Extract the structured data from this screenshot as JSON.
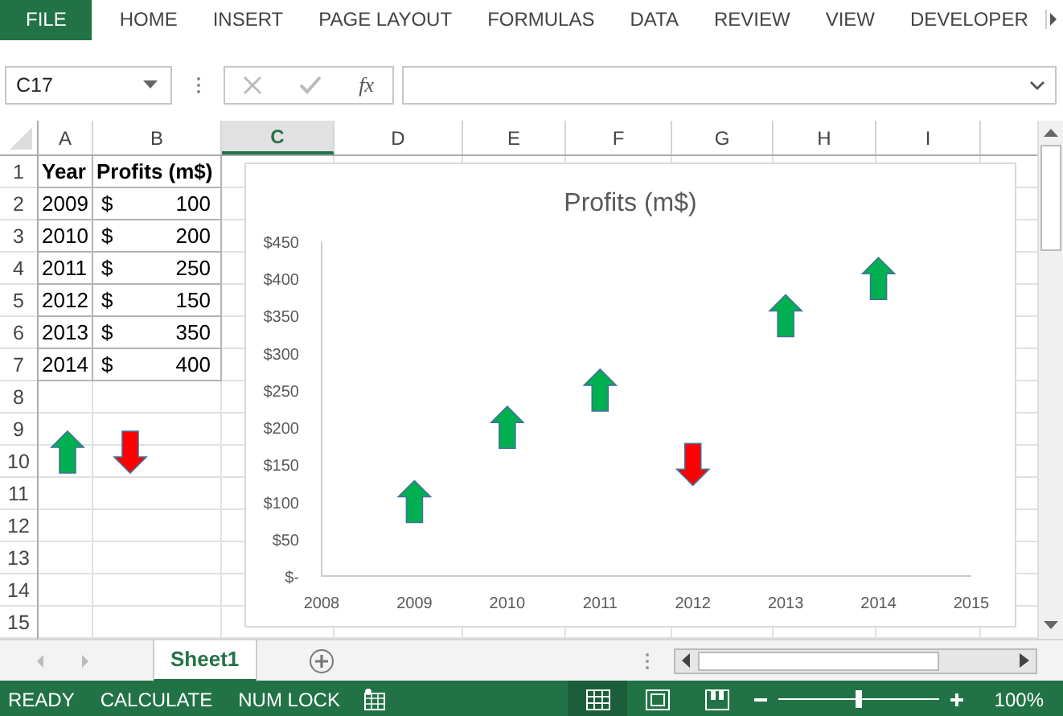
{
  "ribbon": {
    "tabs": [
      {
        "label": "FILE",
        "kind": "file"
      },
      {
        "label": "HOME",
        "kind": "tab"
      },
      {
        "label": "INSERT",
        "kind": "tab"
      },
      {
        "label": "PAGE LAYOUT",
        "kind": "tab"
      },
      {
        "label": "FORMULAS",
        "kind": "tab"
      },
      {
        "label": "DATA",
        "kind": "tab"
      },
      {
        "label": "REVIEW",
        "kind": "tab"
      },
      {
        "label": "VIEW",
        "kind": "tab"
      },
      {
        "label": "DEVELOPER",
        "kind": "tab"
      }
    ]
  },
  "formula_bar": {
    "name_box": "C17",
    "function_button": "fx"
  },
  "sheet": {
    "columns": [
      {
        "label": "A",
        "selected": false
      },
      {
        "label": "B",
        "selected": false
      },
      {
        "label": "C",
        "selected": true
      },
      {
        "label": "D",
        "selected": false
      },
      {
        "label": "E",
        "selected": false
      },
      {
        "label": "F",
        "selected": false
      },
      {
        "label": "G",
        "selected": false
      },
      {
        "label": "H",
        "selected": false
      },
      {
        "label": "I",
        "selected": false
      }
    ],
    "row_numbers": [
      "1",
      "2",
      "3",
      "4",
      "5",
      "6",
      "7",
      "8",
      "9",
      "10",
      "11",
      "12",
      "13",
      "14",
      "15"
    ],
    "table": {
      "header": [
        "Year",
        "Profits (m$)"
      ],
      "rows": [
        {
          "year": "2009",
          "currency": "$",
          "profit": "100"
        },
        {
          "year": "2010",
          "currency": "$",
          "profit": "200"
        },
        {
          "year": "2011",
          "currency": "$",
          "profit": "250"
        },
        {
          "year": "2012",
          "currency": "$",
          "profit": "150"
        },
        {
          "year": "2013",
          "currency": "$",
          "profit": "350"
        },
        {
          "year": "2014",
          "currency": "$",
          "profit": "400"
        }
      ]
    },
    "shapes": [
      {
        "kind": "up",
        "color": "#00b050"
      },
      {
        "kind": "down",
        "color": "#ff0000"
      }
    ],
    "chart": {
      "chart_data": {
        "type": "scatter",
        "title": "Profits (m$)",
        "x": [
          2009,
          2010,
          2011,
          2012,
          2013,
          2014
        ],
        "series": [
          {
            "color": "#00b050",
            "values": [
              100,
              200,
              250,
              null,
              350,
              400
            ]
          },
          {
            "color": "#ff0000",
            "values": [
              null,
              null,
              null,
              150,
              null,
              null
            ]
          }
        ],
        "xlim": [
          2008,
          2015
        ],
        "ylim": [
          0,
          450
        ],
        "xticks": [
          2008,
          2009,
          2010,
          2011,
          2012,
          2013,
          2014,
          2015
        ],
        "yticks": [
          {
            "value": 0,
            "label": "$-"
          },
          {
            "value": 50,
            "label": "$50"
          },
          {
            "value": 100,
            "label": "$100"
          },
          {
            "value": 150,
            "label": "$150"
          },
          {
            "value": 200,
            "label": "$200"
          },
          {
            "value": 250,
            "label": "$250"
          },
          {
            "value": 300,
            "label": "$300"
          },
          {
            "value": 350,
            "label": "$350"
          },
          {
            "value": 400,
            "label": "$400"
          },
          {
            "value": 450,
            "label": "$450"
          }
        ]
      },
      "series_markers": [
        {
          "kind": "up"
        },
        {
          "kind": "down"
        }
      ]
    }
  },
  "sheet_tabs": [
    {
      "label": "Sheet1",
      "selected": true
    }
  ],
  "status_bar": {
    "items": [
      "READY",
      "CALCULATE",
      "NUM LOCK"
    ],
    "zoom": {
      "level": 0.5,
      "reading": "100%"
    }
  }
}
